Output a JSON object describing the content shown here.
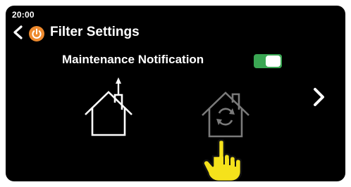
{
  "status_bar": {
    "time": "20:00"
  },
  "header": {
    "title": "Filter Settings",
    "back_icon": "chevron-left-icon",
    "mode_icon": "power-icon",
    "mode_icon_color": "#ee8a2e"
  },
  "setting": {
    "label": "Maintenance Notification",
    "toggle_on": true,
    "toggle_color": "#3aa653"
  },
  "options": [
    {
      "name": "exhaust-mode",
      "icon": "house-exhaust-icon",
      "selected": true
    },
    {
      "name": "recirculation-mode",
      "icon": "house-recirculation-icon",
      "selected": false
    }
  ],
  "navigation": {
    "next_icon": "chevron-right-icon"
  },
  "pointer": {
    "icon": "pointing-hand-icon",
    "color": "#f5e21b"
  }
}
